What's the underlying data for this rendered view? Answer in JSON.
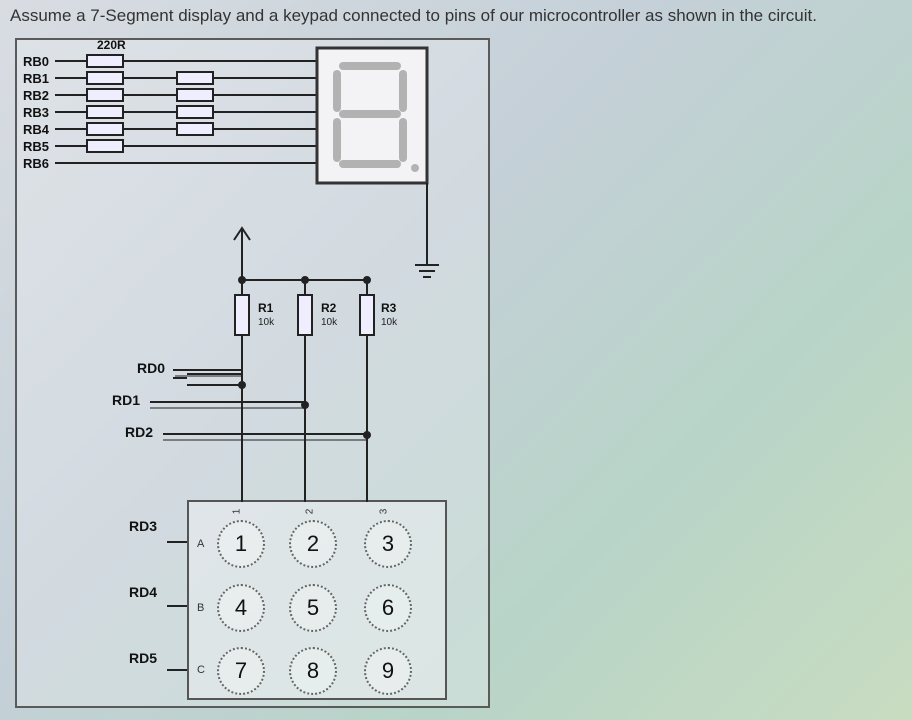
{
  "instruction": "Assume a 7-Segment display and a keypad connected to pins of our microcontroller as shown in the circuit.",
  "series_resistor_label": "220R",
  "rb_pins": [
    "RB0",
    "RB1",
    "RB2",
    "RB3",
    "RB4",
    "RB5",
    "RB6"
  ],
  "pullup_resistors": [
    {
      "name": "R1",
      "value": "10k"
    },
    {
      "name": "R2",
      "value": "10k"
    },
    {
      "name": "R3",
      "value": "10k"
    }
  ],
  "rd_col_pins": [
    "RD0",
    "RD1",
    "RD2"
  ],
  "rd_row_pins": [
    "RD3",
    "RD4",
    "RD5"
  ],
  "keypad": {
    "col_headers": [
      "1",
      "2",
      "3"
    ],
    "row_headers": [
      "A",
      "B",
      "C"
    ],
    "keys": [
      [
        "1",
        "2",
        "3"
      ],
      [
        "4",
        "5",
        "6"
      ],
      [
        "7",
        "8",
        "9"
      ]
    ]
  }
}
